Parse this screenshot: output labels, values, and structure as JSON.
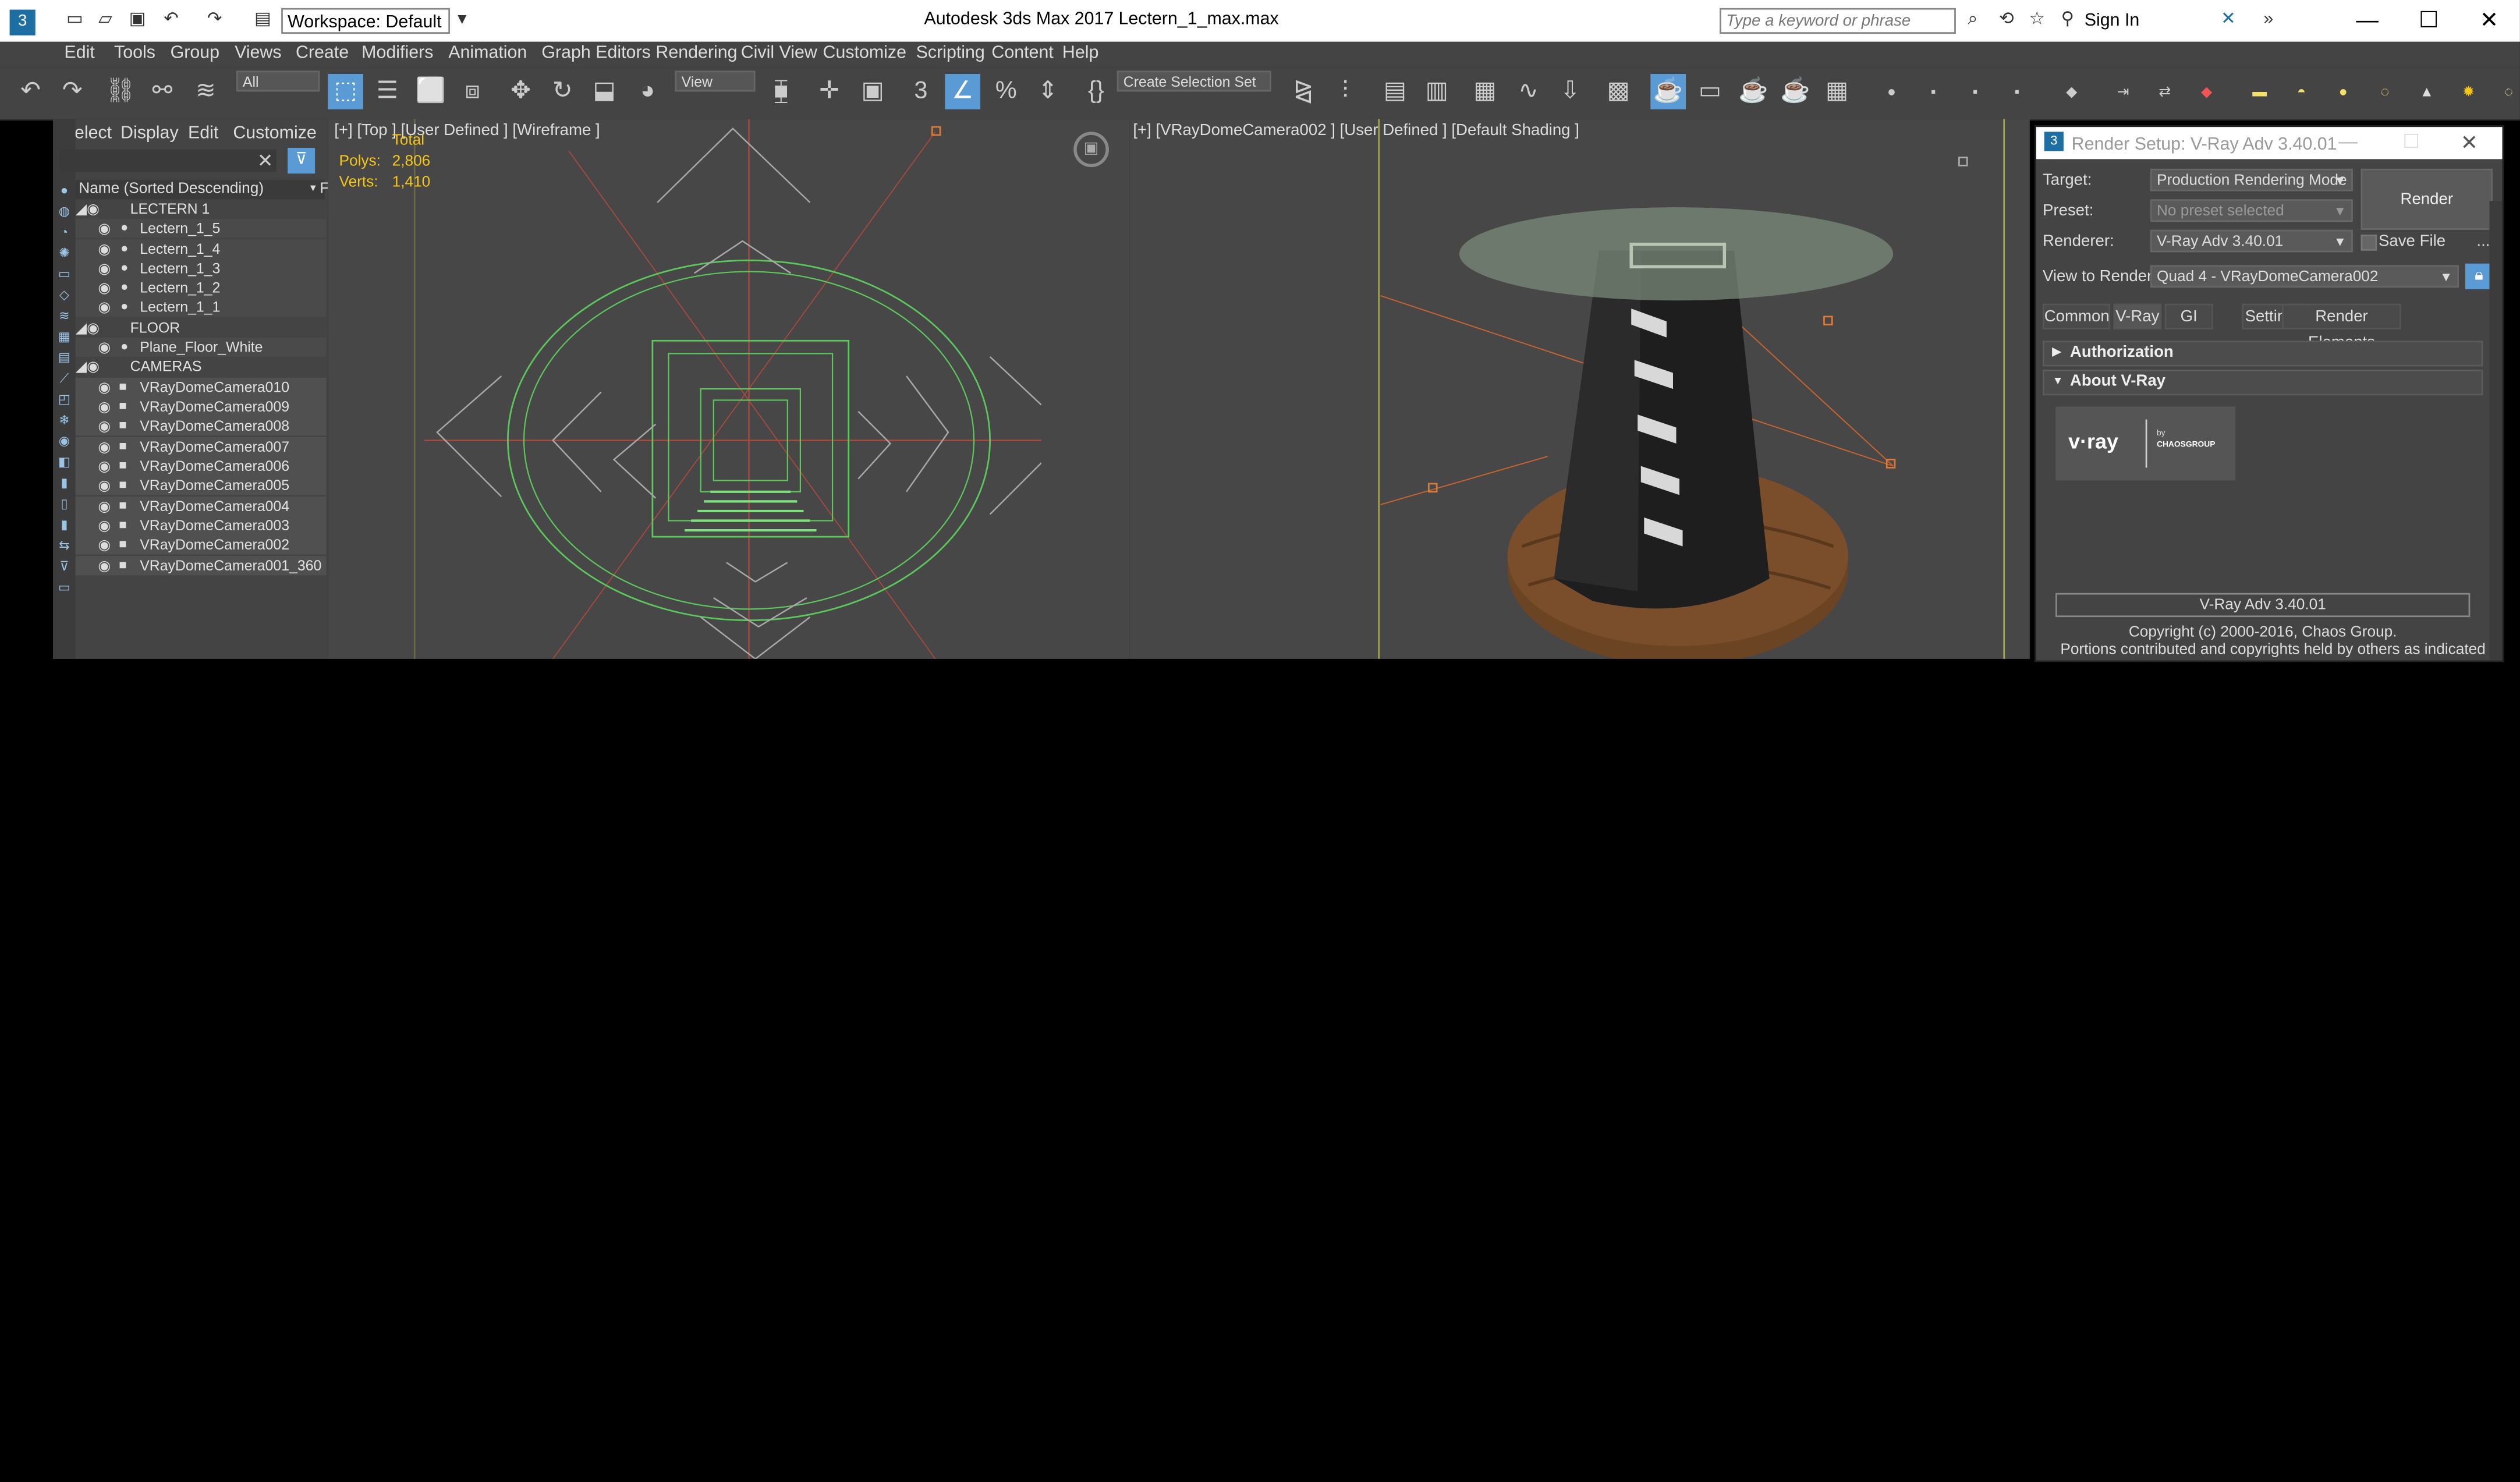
{
  "app": {
    "title": "Autodesk 3ds Max 2017",
    "file": "Lectern_1_max.max",
    "workspace": "Workspace: Default",
    "search_placeholder": "Type a keyword or phrase",
    "sign_in": "Sign In"
  },
  "menu": [
    "Edit",
    "Tools",
    "Group",
    "Views",
    "Create",
    "Modifiers",
    "Animation",
    "Graph Editors",
    "Rendering",
    "Civil View",
    "Customize",
    "Scripting",
    "Content",
    "Help"
  ],
  "toolbar": {
    "filter": "All",
    "ref_coord": "View",
    "selection_set": "Create Selection Set",
    "snap_label": "3"
  },
  "explorer": {
    "menu": [
      "Select",
      "Display",
      "Edit",
      "Customize"
    ],
    "column_header": "Name (Sorted Descending)",
    "column_flag": "F",
    "rows": [
      {
        "label": "LECTERN 1",
        "type": "layer"
      },
      {
        "label": "Lectern_1_5",
        "type": "child"
      },
      {
        "label": "Lectern_1_4",
        "type": "child"
      },
      {
        "label": "Lectern_1_3",
        "type": "child"
      },
      {
        "label": "Lectern_1_2",
        "type": "child"
      },
      {
        "label": "Lectern_1_1",
        "type": "child"
      },
      {
        "label": "FLOOR",
        "type": "layer"
      },
      {
        "label": "Plane_Floor_White",
        "type": "child"
      },
      {
        "label": "CAMERAS",
        "type": "layer"
      },
      {
        "label": "VRayDomeCamera010",
        "type": "cam"
      },
      {
        "label": "VRayDomeCamera009",
        "type": "cam"
      },
      {
        "label": "VRayDomeCamera008",
        "type": "cam"
      },
      {
        "label": "VRayDomeCamera007",
        "type": "cam"
      },
      {
        "label": "VRayDomeCamera006",
        "type": "cam"
      },
      {
        "label": "VRayDomeCamera005",
        "type": "cam"
      },
      {
        "label": "VRayDomeCamera004",
        "type": "cam"
      },
      {
        "label": "VRayDomeCamera003",
        "type": "cam"
      },
      {
        "label": "VRayDomeCamera002",
        "type": "cam"
      },
      {
        "label": "VRayDomeCamera001_360",
        "type": "cam"
      }
    ]
  },
  "viewport_top": {
    "label": "[+] [Top ]  [User Defined ]  [Wireframe ]",
    "total": "Total",
    "polys_label": "Polys:",
    "polys": "2,806",
    "verts_label": "Verts:",
    "verts": "1,410"
  },
  "viewport_persp": {
    "label": "[+] [VRayDomeCamera002 ]  [User Defined ]  [Default Shading ]"
  },
  "render_setup": {
    "title": "Render Setup: V-Ray Adv 3.40.01",
    "target_label": "Target:",
    "target": "Production Rendering Mode",
    "preset_label": "Preset:",
    "preset": "No preset selected",
    "renderer_label": "Renderer:",
    "renderer": "V-Ray Adv 3.40.01",
    "save_file": "Save File",
    "more": "...",
    "view_label": "View to Render:",
    "view": "Quad 4 - VRayDomeCamera002",
    "render_button": "Render",
    "tabs": [
      "Common",
      "V-Ray",
      "GI",
      "Settings",
      "Render Elements"
    ],
    "rollouts": [
      "Authorization",
      "About V-Ray"
    ],
    "logo_text": "v·ray",
    "logo_by": "by",
    "logo_brand": "CHAOSGROUP",
    "version": "V-Ray Adv 3.40.01",
    "copyright": "Copyright (c) 2000-2016, Chaos Group.",
    "portions": "Portions contributed and copyrights held by others as indicated in"
  },
  "colors": {
    "accent": "#5b9bd5",
    "stats": "#f5c518",
    "wire_green": "#5cc85c"
  }
}
